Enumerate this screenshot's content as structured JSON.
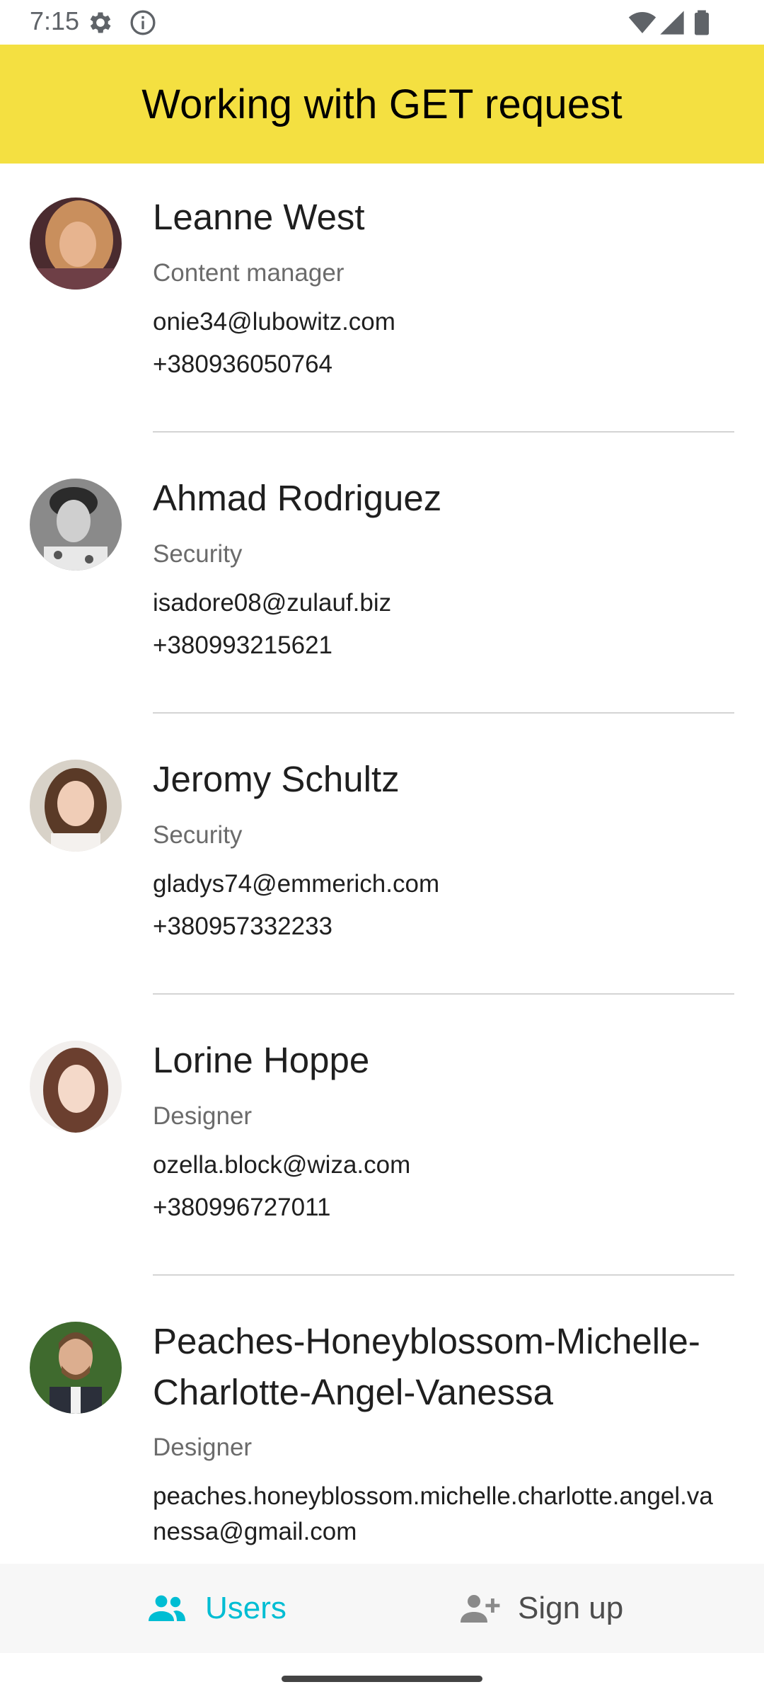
{
  "status_bar": {
    "time": "7:15",
    "left_icons": [
      "gear-icon",
      "info-icon"
    ],
    "right_icons": [
      "wifi-icon",
      "signal-icon",
      "battery-icon"
    ]
  },
  "header": {
    "title": "Working with GET request",
    "background": "#f4e041"
  },
  "users": [
    {
      "name": "Leanne West",
      "position": "Content manager",
      "email": "onie34@lubowitz.com",
      "phone": "+380936050764"
    },
    {
      "name": "Ahmad Rodriguez",
      "position": "Security",
      "email": "isadore08@zulauf.biz",
      "phone": "+380993215621"
    },
    {
      "name": "Jeromy Schultz",
      "position": "Security",
      "email": "gladys74@emmerich.com",
      "phone": "+380957332233"
    },
    {
      "name": "Lorine Hoppe",
      "position": "Designer",
      "email": "ozella.block@wiza.com",
      "phone": "+380996727011"
    },
    {
      "name": "Peaches-Honeyblossom-Michelle-Charlotte-Angel-Vanessa",
      "position": "Designer",
      "email": "peaches.honeyblossom.michelle.charlotte.angel.vanessa@gmail.com",
      "phone": ""
    }
  ],
  "bottom_nav": {
    "users_label": "Users",
    "signup_label": "Sign up",
    "active_color": "#00bdd3",
    "inactive_color": "#4d4d4d"
  }
}
